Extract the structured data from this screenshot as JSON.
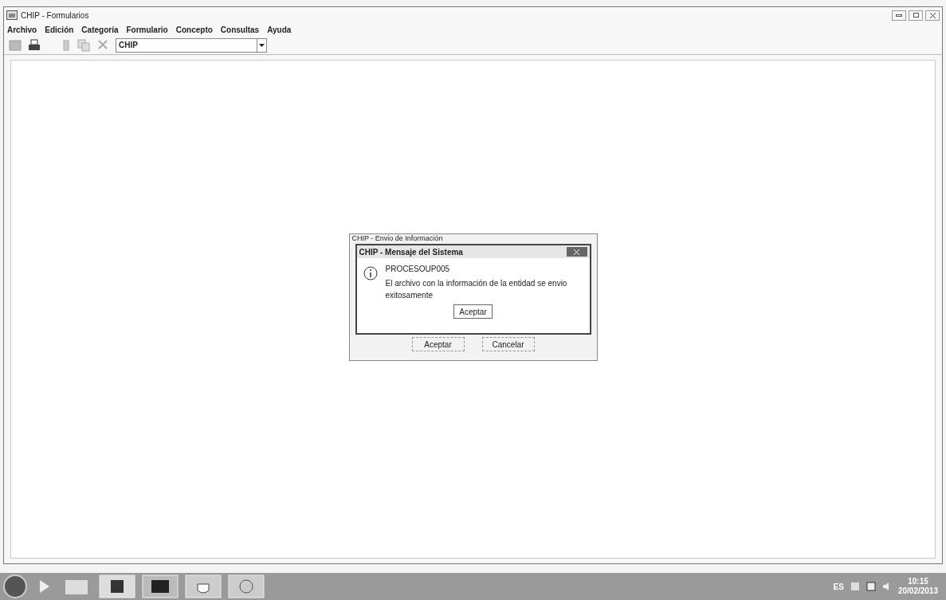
{
  "window": {
    "title": "CHIP - Formularios"
  },
  "menu": [
    "Archivo",
    "Edición",
    "Categoría",
    "Formulario",
    "Concepto",
    "Consultas",
    "Ayuda"
  ],
  "toolbar": {
    "combo_value": "CHIP"
  },
  "back_dialog": {
    "title": "CHIP - Envio de Información",
    "buttons": [
      "Aceptar",
      "Cancelar"
    ]
  },
  "message_dialog": {
    "title": "CHIP - Mensaje del Sistema",
    "code": "PROCESOUP005",
    "message": "El archivo con la información de la entidad se envio exitosamente",
    "button": "Aceptar"
  },
  "tray": {
    "language": "ES",
    "time": "10:15",
    "date": "20/02/2013"
  }
}
